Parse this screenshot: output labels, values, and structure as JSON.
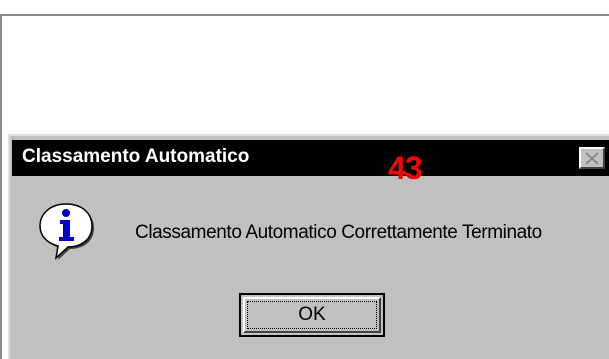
{
  "dialog": {
    "title": "Classamento Automatico",
    "message": "Classamento Automatico Correttamente Terminato",
    "ok_label": "OK"
  },
  "annotation": {
    "text": "43",
    "color": "#ff0000"
  },
  "icons": {
    "info": "information-icon",
    "close": "close-icon"
  },
  "colors": {
    "titlebar": "#000000",
    "dialog_face": "#c0c0c0"
  }
}
